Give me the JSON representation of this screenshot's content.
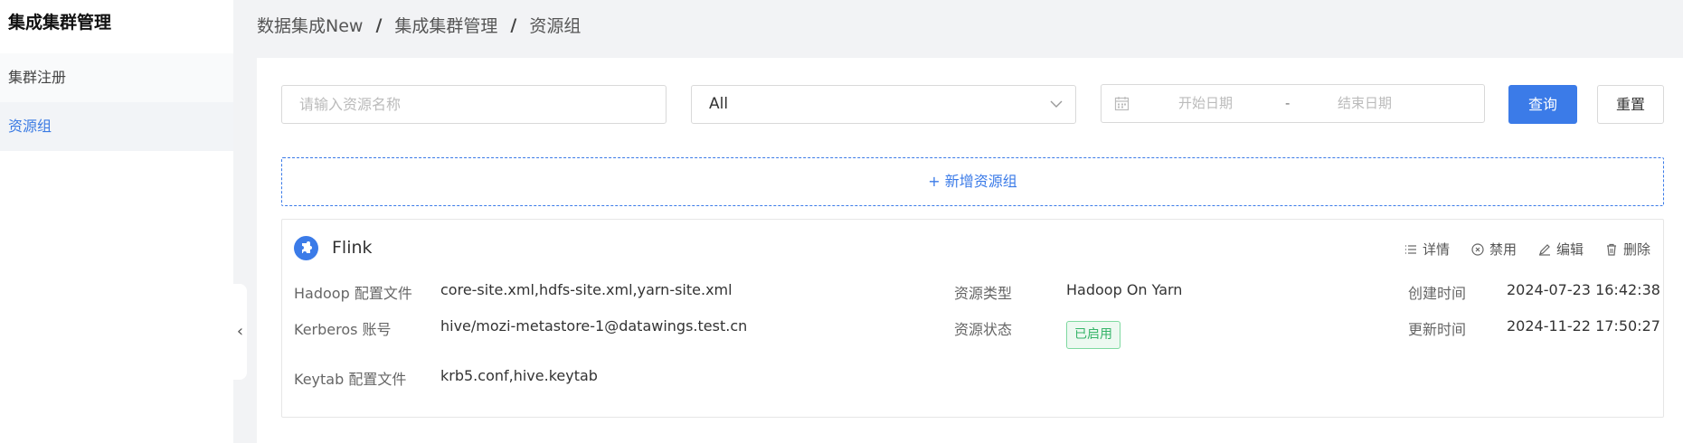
{
  "sidebar": {
    "title": "集成集群管理",
    "items": [
      {
        "label": "集群注册"
      },
      {
        "label": "资源组"
      }
    ]
  },
  "breadcrumb": [
    "数据集成New",
    "集成集群管理",
    "资源组"
  ],
  "filters": {
    "search_placeholder": "请输入资源名称",
    "select_value": "All",
    "date_start_placeholder": "开始日期",
    "date_separator": "-",
    "date_end_placeholder": "结束日期",
    "query_label": "查询",
    "reset_label": "重置"
  },
  "add_label": "+ 新增资源组",
  "card": {
    "title": "Flink",
    "actions": {
      "detail": "详情",
      "disable": "禁用",
      "edit": "编辑",
      "delete": "删除"
    },
    "hadoop_label": "Hadoop 配置文件",
    "hadoop_value": "core-site.xml,hdfs-site.xml,yarn-site.xml",
    "kerberos_label": "Kerberos 账号",
    "kerberos_value": "hive/mozi-metastore-1@datawings.test.cn",
    "keytab_label": "Keytab 配置文件",
    "keytab_value": "krb5.conf,hive.keytab",
    "type_label": "资源类型",
    "type_value": "Hadoop On Yarn",
    "status_label": "资源状态",
    "status_value": "已启用",
    "created_label": "创建时间",
    "created_value": "2024-07-23 16:42:38",
    "updated_label": "更新时间",
    "updated_value": "2024-11-22 17:50:27"
  },
  "colors": {
    "accent": "#3b7be8",
    "status_green": "#34b468"
  }
}
